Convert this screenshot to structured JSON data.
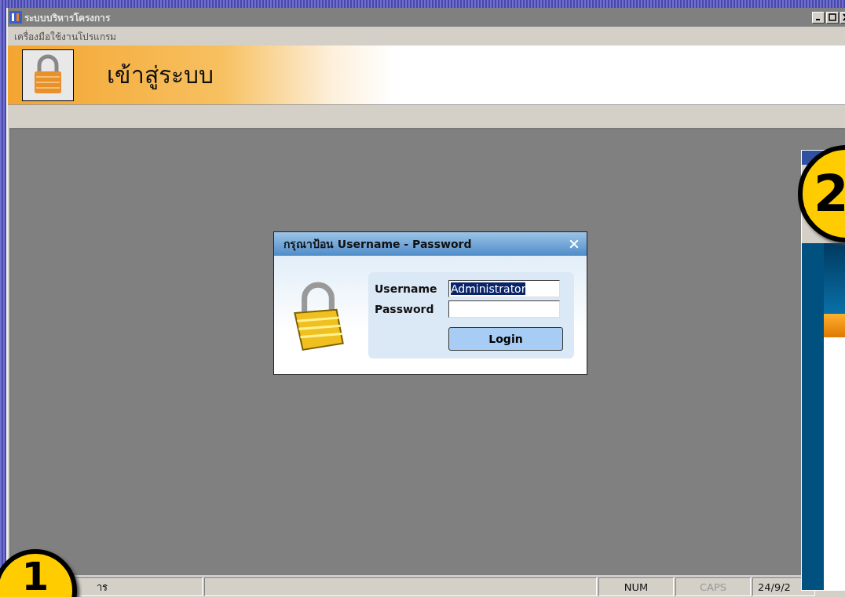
{
  "window": {
    "title": "ระบบบริหารโครงการ"
  },
  "menu": [
    "เครื่องมือใช้งานโปรแกรม"
  ],
  "banner": {
    "title": "เข้าสู่ระบบ"
  },
  "dialog": {
    "title": "กรุณาป้อน Username - Password",
    "fields": [
      {
        "label": "Username",
        "value": "Administrator"
      },
      {
        "label": "Password"
      }
    ],
    "button": "Login"
  },
  "status_bar": [
    {
      "text": "าร",
      "enabled": true
    },
    {
      "text": "NUM",
      "enabled": true
    },
    {
      "text": "CAPS",
      "enabled": false
    },
    {
      "text": "24/9/2",
      "enabled": true
    }
  ],
  "callouts": [
    "1",
    "2"
  ]
}
